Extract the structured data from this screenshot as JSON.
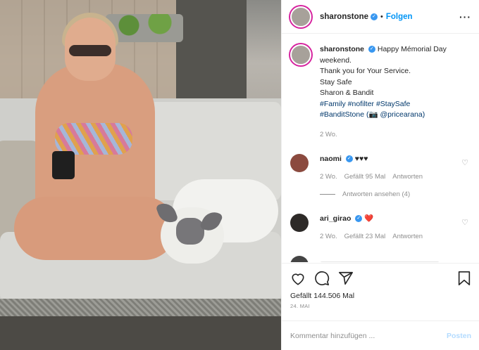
{
  "header": {
    "username": "sharonstone",
    "verified_mark": "✓",
    "separator": "•",
    "follow_label": "Folgen",
    "more_label": "···"
  },
  "caption": {
    "username": "sharonstone",
    "lines": [
      "Happy Mémorial Day",
      "weekend.",
      "Thank you for Your Service.",
      "Stay Safe",
      "Sharon & Bandit",
      "#Family #nofilter #StaySafe",
      "#BanditStone (📷 @pricearana)"
    ],
    "age": "2 Wo."
  },
  "comments": [
    {
      "username": "naomi",
      "text": "♥♥♥",
      "age": "2 Wo.",
      "likes": "Gefällt 95 Mal",
      "reply_label": "Antworten",
      "replies_label": "Antworten ansehen (4)",
      "avatar_color": "#8b4a3f"
    },
    {
      "username": "ari_girao",
      "text": "❤️",
      "age": "2 Wo.",
      "likes": "Gefällt 23 Mal",
      "reply_label": "Antworten",
      "avatar_color": "#2d2a28"
    }
  ],
  "actions": {
    "likes": "Gefällt 144.506 Mal",
    "date": "24. MAI"
  },
  "add_comment": {
    "placeholder": "Kommentar hinzufügen ...",
    "post_label": "Posten"
  },
  "icons": [
    "heart-icon",
    "comment-icon",
    "share-icon",
    "bookmark-icon",
    "verified-icon",
    "more-icon"
  ],
  "colors": {
    "link": "#0095f6",
    "verified": "#3897f0",
    "hashtag": "#00376b",
    "muted": "#8e8e8e"
  }
}
